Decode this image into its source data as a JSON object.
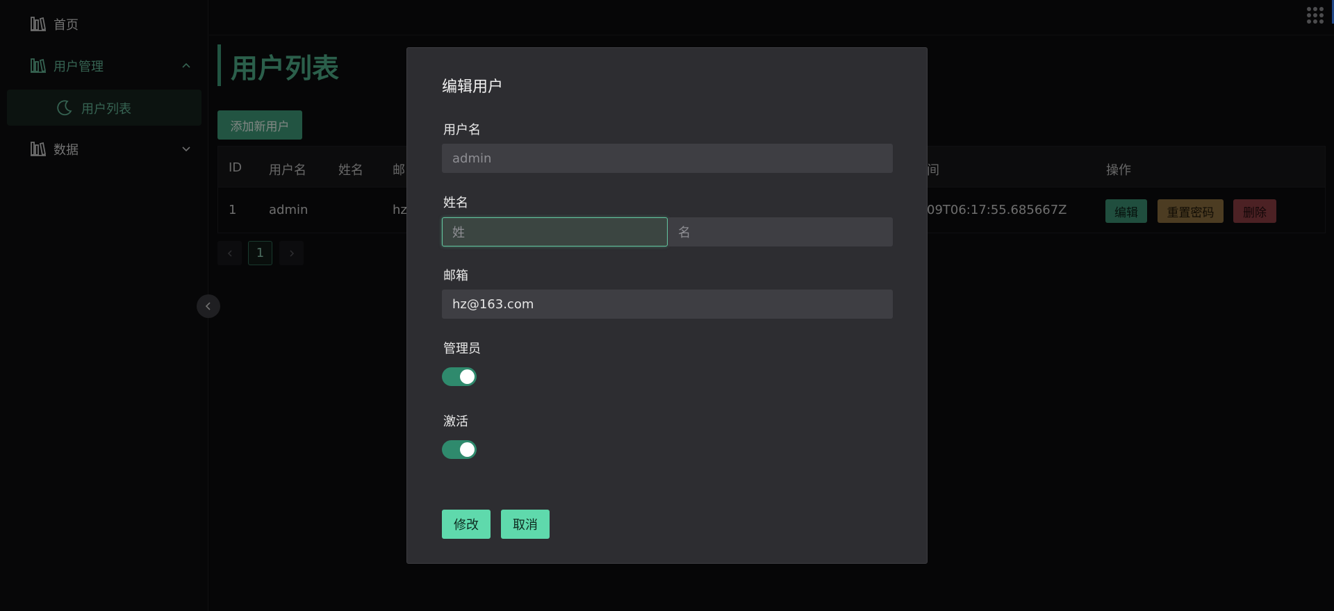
{
  "sidebar": {
    "items": [
      {
        "label": "首页",
        "icon": "library-icon"
      },
      {
        "label": "用户管理",
        "icon": "library-icon",
        "expanded": true,
        "children": [
          {
            "label": "用户列表",
            "icon": "moon-icon",
            "active": true
          }
        ]
      },
      {
        "label": "数据",
        "icon": "library-icon",
        "expanded": false
      }
    ]
  },
  "main": {
    "title": "用户列表",
    "add_button": "添加新用户",
    "table": {
      "headers": [
        "ID",
        "用户名",
        "姓名",
        "邮",
        "间",
        "操作"
      ],
      "rows": [
        {
          "id": "1",
          "username": "admin",
          "name": "",
          "email_partial": "hz",
          "time_partial": "09T06:17:55.685667Z"
        }
      ],
      "actions": {
        "edit": "编辑",
        "reset": "重置密码",
        "delete": "删除"
      }
    },
    "pagination": {
      "current": "1"
    }
  },
  "dialog": {
    "title": "编辑用户",
    "username": {
      "label": "用户名",
      "placeholder": "admin"
    },
    "name": {
      "label": "姓名",
      "last_placeholder": "姓",
      "first_placeholder": "名"
    },
    "email": {
      "label": "邮箱",
      "value": "hz@163.com"
    },
    "admin": {
      "label": "管理员",
      "on": true
    },
    "active": {
      "label": "激活",
      "on": true
    },
    "submit": "修改",
    "cancel": "取消"
  },
  "colors": {
    "accent": "#3f9a78",
    "accent_light": "#5fd9ac",
    "warning": "#8b6d3f",
    "danger": "#8a3d43"
  }
}
